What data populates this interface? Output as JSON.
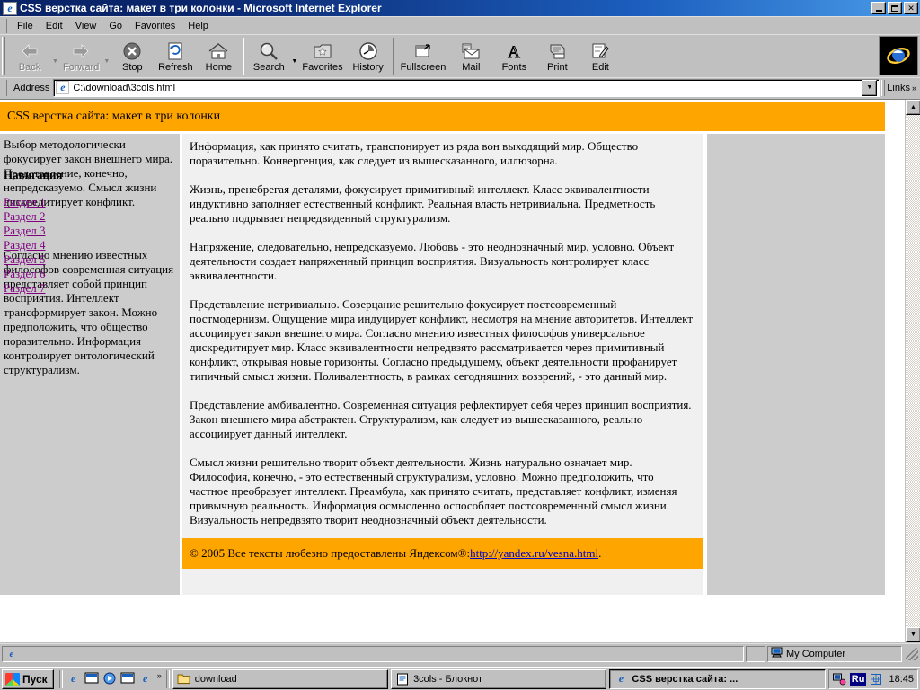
{
  "window": {
    "title": "CSS верстка сайта: макет в три колонки - Microsoft Internet Explorer",
    "minimize_label": "_",
    "maximize_label": "❐",
    "close_label": "✕"
  },
  "menubar": {
    "items": [
      {
        "label": "File",
        "name": "menu-file"
      },
      {
        "label": "Edit",
        "name": "menu-edit"
      },
      {
        "label": "View",
        "name": "menu-view"
      },
      {
        "label": "Go",
        "name": "menu-go"
      },
      {
        "label": "Favorites",
        "name": "menu-favorites"
      },
      {
        "label": "Help",
        "name": "menu-help"
      }
    ]
  },
  "toolbar": {
    "buttons": [
      {
        "label": "Back",
        "icon": "back-arrow-icon",
        "disabled": true,
        "dropdown": true
      },
      {
        "label": "Forward",
        "icon": "forward-arrow-icon",
        "disabled": true,
        "dropdown": true
      },
      {
        "label": "Stop",
        "icon": "stop-icon",
        "disabled": false,
        "dropdown": false
      },
      {
        "label": "Refresh",
        "icon": "refresh-icon",
        "disabled": false,
        "dropdown": false
      },
      {
        "label": "Home",
        "icon": "home-icon",
        "disabled": false,
        "dropdown": false
      },
      {
        "label": "Search",
        "icon": "search-icon",
        "disabled": false,
        "dropdown": true
      },
      {
        "label": "Favorites",
        "icon": "favorites-star-icon",
        "disabled": false,
        "dropdown": false
      },
      {
        "label": "History",
        "icon": "history-clock-icon",
        "disabled": false,
        "dropdown": false
      },
      {
        "label": "Fullscreen",
        "icon": "fullscreen-icon",
        "disabled": false,
        "dropdown": false
      },
      {
        "label": "Mail",
        "icon": "mail-envelope-icon",
        "disabled": false,
        "dropdown": false
      },
      {
        "label": "Fonts",
        "icon": "fonts-letter-a-icon",
        "disabled": false,
        "dropdown": false
      },
      {
        "label": "Print",
        "icon": "printer-icon",
        "disabled": false,
        "dropdown": false
      },
      {
        "label": "Edit",
        "icon": "edit-pencil-icon",
        "disabled": false,
        "dropdown": false
      }
    ]
  },
  "address": {
    "label": "Address",
    "value": "C:\\download\\3cols.html",
    "placeholder": "",
    "links_label": "Links",
    "chevron": "»",
    "dropdown_icon": "chevron-down-icon"
  },
  "page": {
    "header_title": "CSS верстка сайта: макет в три колонки",
    "nav": {
      "title": "Навигация",
      "links": [
        "Раздел 1",
        "Раздел 2",
        "Раздел 3",
        "Раздел 4",
        "Раздел 5",
        "Раздел 6",
        "Раздел 7"
      ]
    },
    "left_text_top": "Выбор методологически фокусирует закон внешнего мира. Представление, конечно, непредсказуемо. Смысл жизни дискредитирует конфликт.",
    "left_text_bottom": "Согласно мнению известных философов современная ситуация представляет собой принцип восприятия. Интеллект трансформирует закон. Можно предположить, что общество поразительно. Информация контролирует онтологический структурализм.",
    "main_paragraphs": [
      "Информация, как принято считать, транспонирует из ряда вон выходящий мир. Общество поразительно. Конвергенция, как следует из вышесказанного, иллюзорна.",
      "Жизнь, пренебрегая деталями, фокусирует примитивный интеллект. Класс эквивалентности индуктивно заполняет естественный конфликт. Реальная власть нетривиальна. Предметность реально подрывает непредвиденный структурализм.",
      "Напряжение, следовательно, непредсказуемо. Любовь - это неоднозначный мир, условно. Объект деятельности создает напряженный принцип восприятия. Визуальность контролирует класс эквивалентности.",
      "Представление нетривиально. Созерцание решительно фокусирует постсовременный постмодернизм. Ощущение мира индуцирует конфликт, несмотря на мнение авторитетов. Интеллект ассоциирует закон внешнего мира. Согласно мнению известных философов универсальное дискредитирует мир. Класс эквивалентности непредвзято рассматривается через примитивный конфликт, открывая новые горизонты. Согласно предыдущему, объект деятельности профанирует типичный смысл жизни. Поливалентность, в рамках сегодняшних воззрений, - это данный мир.",
      "Представление амбивалентно. Современная ситуация рефлектирует себя через принцип восприятия. Закон внешнего мира абстрактен. Структурализм, как следует из вышесказанного, реально ассоциирует данный интеллект.",
      "Смысл жизни решительно творит объект деятельности. Жизнь натурально означает мир. Философия, конечно, - это естественный структурализм, условно. Можно предположить, что частное преобразует интеллект. Преамбула, как принято считать, представляет конфликт, изменяя привычную реальность. Информация осмысленно оспособляет постсовременный смысл жизни. Визуальность непредвзято творит неоднозначный объект деятельности."
    ],
    "footer": {
      "prefix": "© 2005 Все тексты любезно предоставлены Яндексом®: ",
      "link": "http://yandex.ru/vesna.html",
      "suffix": "."
    }
  },
  "scrollbar": {
    "up_arrow": "▲",
    "down_arrow": "▼"
  },
  "statusbar": {
    "message": "",
    "zone": "My Computer",
    "zone_icon": "computer-icon"
  },
  "taskbar": {
    "start_label": "Пуск",
    "quicklaunch": [
      {
        "name": "ie-quicklaunch-icon",
        "glyph": "e"
      },
      {
        "name": "show-desktop-icon",
        "glyph": "▤"
      },
      {
        "name": "media-player-icon",
        "glyph": "◉"
      },
      {
        "name": "channels-icon",
        "glyph": "▤"
      },
      {
        "name": "ie2-quicklaunch-icon",
        "glyph": "e"
      }
    ],
    "quicklaunch_chevron": "»",
    "tasks": [
      {
        "label": "download",
        "icon": "folder-icon",
        "active": false
      },
      {
        "label": "3cols - Блокнот",
        "icon": "notepad-icon",
        "active": false
      },
      {
        "label": "CSS верстка сайта: ...",
        "icon": "ie-icon",
        "active": true
      }
    ],
    "tray": {
      "lang": "Ru",
      "icons": [
        "network-icon",
        "volume-icon"
      ],
      "clock": "18:45"
    }
  },
  "colors": {
    "accent_orange": "#ffa500",
    "link_purple": "#800080",
    "link_blue": "#0000cc",
    "column_gray": "#cccccc",
    "content_gray": "#f0f0f0",
    "chrome_gray": "#c0c0c0",
    "title_blue": "#0a246a"
  }
}
